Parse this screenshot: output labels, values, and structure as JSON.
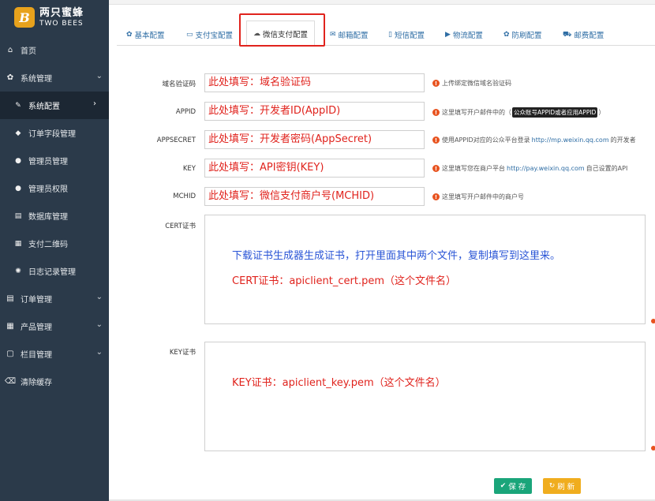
{
  "logo": {
    "mark": "B",
    "name_cn": "两只蜜蜂",
    "name_en": "TWO BEES"
  },
  "sidebar": {
    "items": [
      {
        "label": "首页",
        "icon": "home-icon",
        "glyph": "⌂",
        "level": "top"
      },
      {
        "label": "系统管理",
        "icon": "gear-icon",
        "glyph": "✿",
        "level": "top",
        "expanded": true
      },
      {
        "label": "系统配置",
        "icon": "wrench-icon",
        "glyph": "✎",
        "level": "sub",
        "active": true
      },
      {
        "label": "订单字段管理",
        "icon": "tag-icon",
        "glyph": "◆",
        "level": "sub"
      },
      {
        "label": "管理员管理",
        "icon": "user-icon",
        "glyph": "●",
        "level": "sub"
      },
      {
        "label": "管理员权限",
        "icon": "users-icon",
        "glyph": "●",
        "level": "sub"
      },
      {
        "label": "数据库管理",
        "icon": "database-icon",
        "glyph": "▤",
        "level": "sub"
      },
      {
        "label": "支付二维码",
        "icon": "qrcode-icon",
        "glyph": "▦",
        "level": "sub"
      },
      {
        "label": "日志记录管理",
        "icon": "paw-icon",
        "glyph": "✺",
        "level": "sub"
      },
      {
        "label": "订单管理",
        "icon": "list-icon",
        "glyph": "▤",
        "level": "top"
      },
      {
        "label": "产品管理",
        "icon": "grid-icon",
        "glyph": "▦",
        "level": "top"
      },
      {
        "label": "栏目管理",
        "icon": "file-icon",
        "glyph": "▢",
        "level": "top"
      },
      {
        "label": "清除缓存",
        "icon": "trash-icon",
        "glyph": "⌫",
        "level": "top"
      }
    ]
  },
  "tabs": [
    {
      "label": "基本配置",
      "icon": "gear-icon",
      "glyph": "✿"
    },
    {
      "label": "支付宝配置",
      "icon": "credit-card-icon",
      "glyph": "▭"
    },
    {
      "label": "微信支付配置",
      "icon": "wechat-icon",
      "glyph": "☁",
      "active": true
    },
    {
      "label": "邮箱配置",
      "icon": "envelope-icon",
      "glyph": "✉"
    },
    {
      "label": "短信配置",
      "icon": "mobile-icon",
      "glyph": "▯"
    },
    {
      "label": "物流配置",
      "icon": "truck-icon",
      "glyph": "▶"
    },
    {
      "label": "防刷配置",
      "icon": "shield-gear-icon",
      "glyph": "✿"
    },
    {
      "label": "邮费配置",
      "icon": "cart-icon",
      "glyph": "⛟"
    }
  ],
  "form": {
    "domain": {
      "label": "域名验证码",
      "value": "此处填写：域名验证码",
      "help": "上传绑定微信域名验证码"
    },
    "appid": {
      "label": "APPID",
      "value": "此处填写：开发者ID(AppID)",
      "help_pre": "这里填写开户邮件中的（",
      "help_tag": "公众账号APPID或者应用APPID",
      "help_post": "）"
    },
    "appsecret": {
      "label": "APPSECRET",
      "value": "此处填写：开发者密码(AppSecret)",
      "help_pre": "使用APPID对应的公众平台登录",
      "help_link": "http://mp.weixin.qq.com",
      "help_post": "的开发者"
    },
    "key": {
      "label": "KEY",
      "value": "此处填写：API密钥(KEY)",
      "help_pre": "这里填写您在商户平台",
      "help_link": "http://pay.weixin.qq.com",
      "help_post": "自己设置的API"
    },
    "mchid": {
      "label": "MCHID",
      "value": "此处填写：微信支付商户号(MCHID)",
      "help": "这里填写开户邮件中的商户号"
    },
    "cert": {
      "label": "CERT证书",
      "line1": "下载证书生成器生成证书，打开里面其中两个文件，复制填写到这里来。",
      "line2": "CERT证书：apiclient_cert.pem（这个文件名）"
    },
    "keycert": {
      "label": "KEY证书",
      "line1": "KEY证书：apiclient_key.pem（这个文件名）"
    }
  },
  "buttons": {
    "save": "保 存",
    "refresh": "刷 新"
  },
  "colors": {
    "sidebar": "#2b3a4a",
    "active": "#1c2733",
    "annotation": "#e0231d",
    "save": "#1aa57a",
    "refresh": "#f0ad1e",
    "link": "#2e6da4"
  }
}
